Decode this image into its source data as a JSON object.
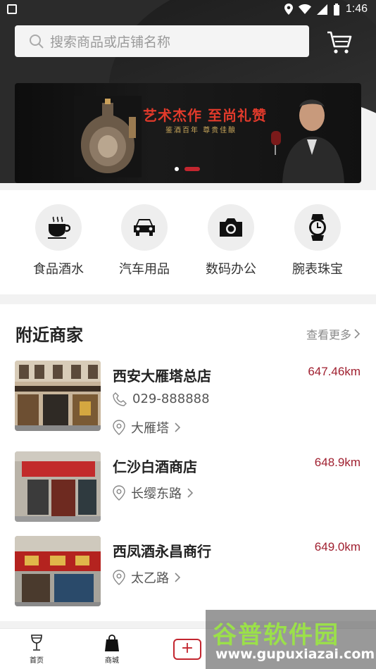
{
  "status_bar": {
    "time": "1:46"
  },
  "search": {
    "placeholder": "搜索商品或店铺名称"
  },
  "banner": {
    "title": "艺术杰作  至尚礼赞",
    "subtitle": "鉴酒百年  尊贵佳酿",
    "slide_count": 2,
    "active_slide": 2
  },
  "categories": [
    {
      "label": "食品酒水",
      "icon": "coffee-cup-icon"
    },
    {
      "label": "汽车用品",
      "icon": "car-icon"
    },
    {
      "label": "数码办公",
      "icon": "camera-icon"
    },
    {
      "label": "腕表珠宝",
      "icon": "watch-icon"
    }
  ],
  "nearby": {
    "title": "附近商家",
    "more_label": "查看更多",
    "shops": [
      {
        "name": "西安大雁塔总店",
        "distance": "647.46km",
        "phone": "029-888888",
        "address": "大雁塔"
      },
      {
        "name": "仁沙白酒商店",
        "distance": "648.9km",
        "address": "长缨东路"
      },
      {
        "name": "西凤酒永昌商行",
        "distance": "649.0km",
        "address": "太乙路"
      }
    ]
  },
  "tabbar": {
    "tabs": [
      {
        "label": "首页",
        "icon": "wine-glass-icon"
      },
      {
        "label": "商城",
        "icon": "shopping-bag-icon"
      }
    ],
    "add_symbol": "+"
  },
  "watermark": {
    "brand": "谷普软件园",
    "url": "www.gupuxiazai.com"
  },
  "colors": {
    "accent": "#c3262f",
    "distance": "#a02030",
    "header_dark": "#2b2b2b"
  }
}
